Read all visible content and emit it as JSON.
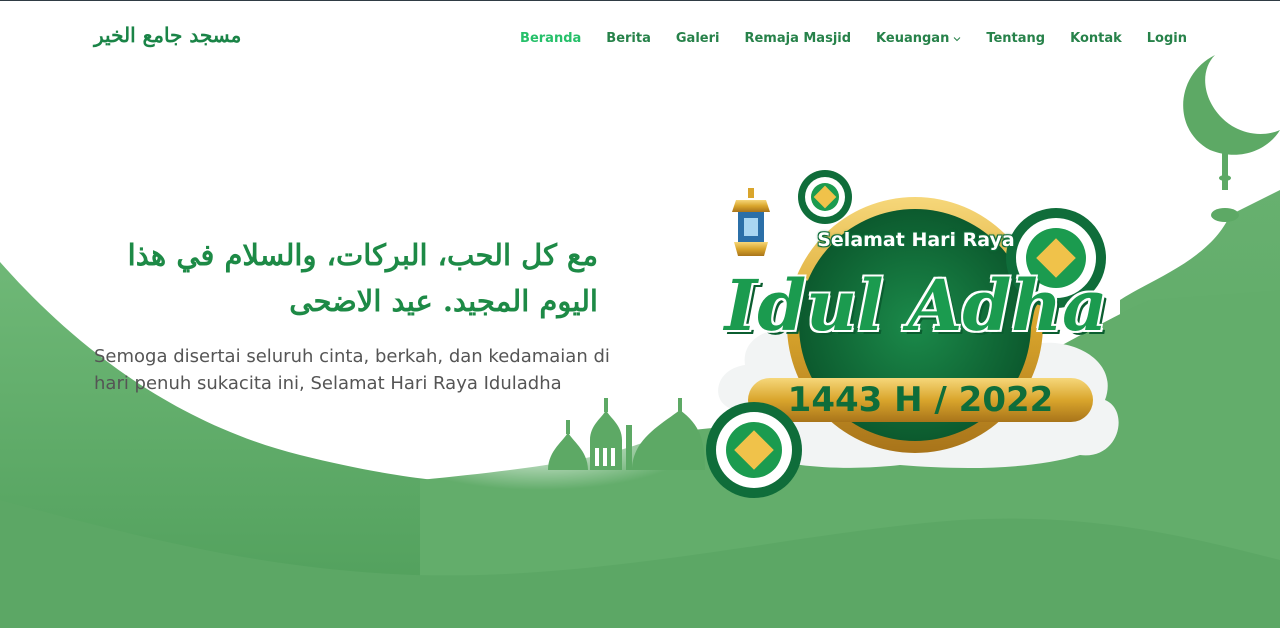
{
  "brand": {
    "name": "مسجد جامع الخير"
  },
  "nav": {
    "items": [
      {
        "label": "Beranda",
        "active": true
      },
      {
        "label": "Berita"
      },
      {
        "label": "Galeri"
      },
      {
        "label": "Remaja Masjid"
      },
      {
        "label": "Keuangan",
        "dropdown": true
      },
      {
        "label": "Tentang"
      },
      {
        "label": "Kontak"
      },
      {
        "label": "Login"
      }
    ]
  },
  "hero": {
    "title": "مع كل الحب، البركات، والسلام في هذا اليوم المجيد. عيد الاضحى",
    "subtitle": "Semoga disertai seluruh cinta, berkah, dan kedamaian di hari penuh sukacita ini, Selamat Hari Raya Iduladha"
  },
  "badge": {
    "top_text": "Selamat Hari Raya",
    "main_text": "Idul Adha",
    "year_text": "1443 H / 2022"
  },
  "colors": {
    "brand_green": "#1a8447",
    "nav_active": "#26c06a",
    "hill_green": "#5faa67",
    "gold": "#d9a52c"
  }
}
